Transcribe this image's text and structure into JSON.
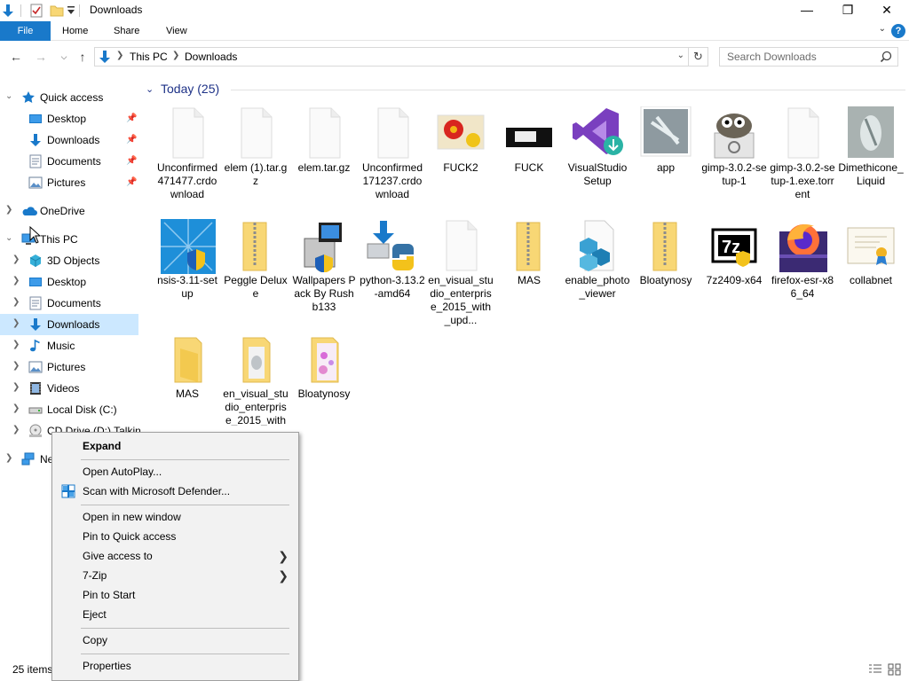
{
  "window": {
    "title": "Downloads",
    "controls": {
      "minimize": "—",
      "maximize": "❐",
      "close": "✕"
    }
  },
  "ribbon": {
    "tabs": [
      "File",
      "Home",
      "Share",
      "View"
    ],
    "help": "?"
  },
  "address": {
    "crumbs": [
      "This PC",
      "Downloads"
    ],
    "search_placeholder": "Search Downloads"
  },
  "nav": {
    "items": [
      {
        "label": "Quick access",
        "icon": "star-icon"
      },
      {
        "label": "Desktop",
        "icon": "desktop-icon",
        "pinned": true
      },
      {
        "label": "Downloads",
        "icon": "download-icon",
        "pinned": true
      },
      {
        "label": "Documents",
        "icon": "documents-icon",
        "pinned": true
      },
      {
        "label": "Pictures",
        "icon": "pictures-icon",
        "pinned": true
      },
      {
        "label": "OneDrive",
        "icon": "cloud-icon"
      },
      {
        "label": "This PC",
        "icon": "computer-icon"
      },
      {
        "label": "3D Objects",
        "icon": "cube-icon"
      },
      {
        "label": "Desktop",
        "icon": "desktop-icon"
      },
      {
        "label": "Documents",
        "icon": "documents-icon"
      },
      {
        "label": "Downloads",
        "icon": "download-icon",
        "selected": true
      },
      {
        "label": "Music",
        "icon": "music-icon"
      },
      {
        "label": "Pictures",
        "icon": "pictures-icon"
      },
      {
        "label": "Videos",
        "icon": "videos-icon"
      },
      {
        "label": "Local Disk (C:)",
        "icon": "disk-icon"
      },
      {
        "label": "CD Drive (D:) Talkin",
        "icon": "cd-drive-icon"
      },
      {
        "label": "Ne",
        "icon": "network-icon"
      }
    ]
  },
  "group": {
    "label": "Today (25)"
  },
  "files": [
    {
      "label": "Unconfirmed 471477.crdownload",
      "icon": "blank-file-icon"
    },
    {
      "label": "elem (1).tar.gz",
      "icon": "blank-file-icon"
    },
    {
      "label": "elem.tar.gz",
      "icon": "blank-file-icon"
    },
    {
      "label": "Unconfirmed 171237.crdownload",
      "icon": "blank-file-icon"
    },
    {
      "label": "FUCK2",
      "icon": "flower-image-icon"
    },
    {
      "label": "FUCK",
      "icon": "dark-image-icon"
    },
    {
      "label": "VisualStudioSetup",
      "icon": "visual-studio-icon"
    },
    {
      "label": "app",
      "icon": "glass-image-icon"
    },
    {
      "label": "gimp-3.0.2-setup-1",
      "icon": "gimp-icon"
    },
    {
      "label": "gimp-3.0.2-setup-1.exe.torrent",
      "icon": "blank-file-icon"
    },
    {
      "label": "Dimethicone_Liquid",
      "icon": "glass-image-icon"
    },
    {
      "label": "nsis-3.11-setup",
      "icon": "nsis-installer-icon"
    },
    {
      "label": "Peggle Deluxe",
      "icon": "zip-folder-icon"
    },
    {
      "label": "Wallpapers Pack By Rushb133",
      "icon": "installer-icon"
    },
    {
      "label": "python-3.13.2-amd64",
      "icon": "python-installer-icon"
    },
    {
      "label": "en_visual_studio_enterprise_2015_with_upd...",
      "icon": "blank-file-icon"
    },
    {
      "label": "MAS",
      "icon": "zip-folder-icon"
    },
    {
      "label": "enable_photo_viewer",
      "icon": "registry-file-icon"
    },
    {
      "label": "Bloatynosy",
      "icon": "zip-folder-icon"
    },
    {
      "label": "7z2409-x64",
      "icon": "7zip-icon"
    },
    {
      "label": "firefox-esr-x86_64",
      "icon": "firefox-icon"
    },
    {
      "label": "collabnet",
      "icon": "certificate-icon"
    },
    {
      "label": "MAS",
      "icon": "folder-icon"
    },
    {
      "label": "en_visual_studio_enterprise_2015_with_upd",
      "icon": "folder-icon"
    },
    {
      "label": "Bloatynosy",
      "icon": "folder-icon"
    }
  ],
  "status": {
    "count": "25 items"
  },
  "context_menu": {
    "items": [
      {
        "label": "Expand",
        "bold": true
      },
      {
        "separator": true
      },
      {
        "label": "Open AutoPlay..."
      },
      {
        "label": "Scan with Microsoft Defender...",
        "icon": "defender-icon"
      },
      {
        "separator": true
      },
      {
        "label": "Open in new window"
      },
      {
        "label": "Pin to Quick access"
      },
      {
        "label": "Give access to",
        "submenu": true
      },
      {
        "label": "7-Zip",
        "submenu": true
      },
      {
        "label": "Pin to Start"
      },
      {
        "label": "Eject"
      },
      {
        "separator": true
      },
      {
        "label": "Copy"
      },
      {
        "separator": true
      },
      {
        "label": "Properties"
      }
    ]
  },
  "colors": {
    "accent": "#1979ca",
    "selection": "#cce8ff",
    "group_header": "#1e3287",
    "folder": "#f8d775"
  }
}
